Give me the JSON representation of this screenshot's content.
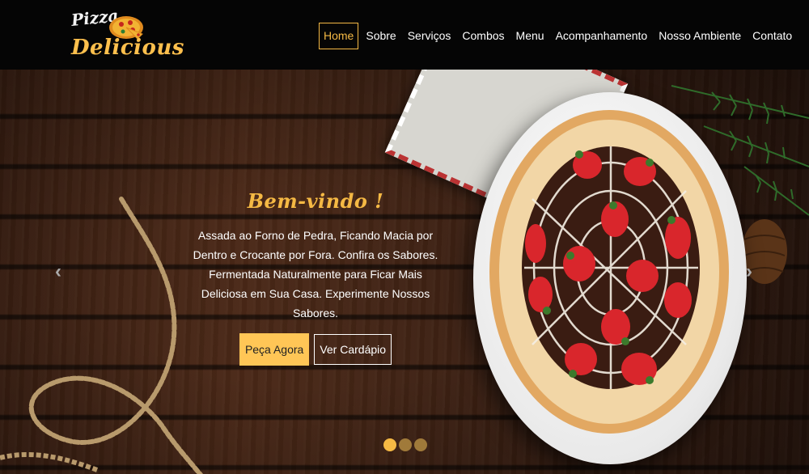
{
  "brand": {
    "line1": "Pizza",
    "line2": "Delicious"
  },
  "nav": {
    "items": [
      {
        "label": "Home",
        "active": true
      },
      {
        "label": "Sobre"
      },
      {
        "label": "Serviços"
      },
      {
        "label": "Combos"
      },
      {
        "label": "Menu"
      },
      {
        "label": "Acompanhamento"
      },
      {
        "label": "Nosso Ambiente"
      },
      {
        "label": "Contato"
      }
    ]
  },
  "hero": {
    "title": "Bem-vindo !",
    "text": "Assada ao Forno de Pedra, Ficando Macia por Dentro e Crocante por Fora. Confira os Sabores. Fermentada Naturalmente para Ficar Mais Deliciosa em Sua Casa. Experimente Nossos Sabores.",
    "primary_button": "Peça Agora",
    "secondary_button": "Ver Cardápio",
    "prev_icon": "chevron-left-icon",
    "next_icon": "chevron-right-icon",
    "slides": 3,
    "active_slide": 1
  },
  "colors": {
    "accent": "#f5b944",
    "button": "#ffc656",
    "header_bg": "#050505"
  }
}
